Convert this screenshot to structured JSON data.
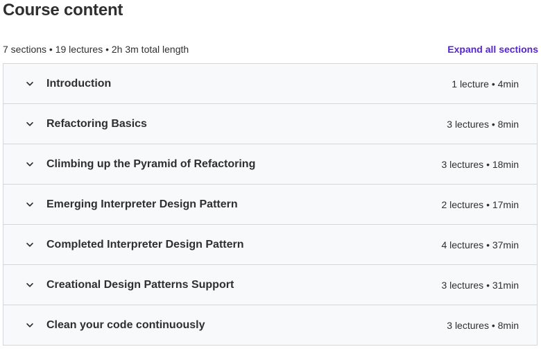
{
  "header": {
    "title": "Course content",
    "summary": "7 sections • 19 lectures • 2h 3m total length",
    "expand_label": "Expand all sections"
  },
  "colors": {
    "link": "#5624d0",
    "section_bg": "#f7f9fa",
    "border": "#d1d7dc",
    "text": "#2d2f31"
  },
  "sections": [
    {
      "title": "Introduction",
      "meta": "1 lecture • 4min",
      "icon": "chevron-down-icon"
    },
    {
      "title": "Refactoring Basics",
      "meta": "3 lectures • 8min",
      "icon": "chevron-down-icon"
    },
    {
      "title": "Climbing up the Pyramid of Refactoring",
      "meta": "3 lectures • 18min",
      "icon": "chevron-down-icon"
    },
    {
      "title": "Emerging Interpreter Design Pattern",
      "meta": "2 lectures • 17min",
      "icon": "chevron-down-icon"
    },
    {
      "title": "Completed Interpreter Design Pattern",
      "meta": "4 lectures • 37min",
      "icon": "chevron-down-icon"
    },
    {
      "title": "Creational Design Patterns Support",
      "meta": "3 lectures • 31min",
      "icon": "chevron-down-icon"
    },
    {
      "title": "Clean your code continuously",
      "meta": "3 lectures • 8min",
      "icon": "chevron-down-icon"
    }
  ]
}
